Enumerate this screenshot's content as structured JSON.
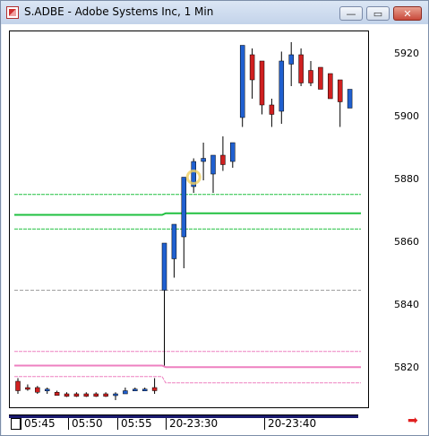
{
  "window": {
    "title": "S.ADBE - Adobe Systems Inc, 1 Min",
    "icon": "chart-app-icon",
    "buttons": {
      "minimize": "—",
      "maximize": "▭",
      "close": "✕"
    }
  },
  "chart_data": {
    "type": "candlestick",
    "title": "",
    "y_ticks": [
      "5920",
      "5900",
      "5880",
      "5860",
      "5840",
      "5820"
    ],
    "ylim": [
      5808,
      5928
    ],
    "x_tick_labels": [
      "05:45",
      "05:50",
      "05:55",
      "20-23:30",
      "20-23:40"
    ],
    "colors": {
      "up": "#2060d0",
      "down": "#d02020",
      "green_band": "#20c040",
      "pink_band": "#ee80c0",
      "gray_line": "#a0a0a0"
    },
    "candles": [
      {
        "o": 5816,
        "h": 5817,
        "l": 5812,
        "c": 5813
      },
      {
        "o": 5814,
        "h": 5815,
        "l": 5813,
        "c": 5813.5
      },
      {
        "o": 5814,
        "h": 5814.5,
        "l": 5812,
        "c": 5812.5
      },
      {
        "o": 5813,
        "h": 5814,
        "l": 5812,
        "c": 5813.5
      },
      {
        "o": 5812.5,
        "h": 5813,
        "l": 5811.5,
        "c": 5811.5
      },
      {
        "o": 5812,
        "h": 5812.5,
        "l": 5811,
        "c": 5811.2
      },
      {
        "o": 5812,
        "h": 5812.5,
        "l": 5811,
        "c": 5811.2
      },
      {
        "o": 5812,
        "h": 5812.5,
        "l": 5811,
        "c": 5811.2
      },
      {
        "o": 5812,
        "h": 5812.5,
        "l": 5811,
        "c": 5811.2
      },
      {
        "o": 5812,
        "h": 5812.5,
        "l": 5811,
        "c": 5811.2
      },
      {
        "o": 5811.5,
        "h": 5812.5,
        "l": 5810,
        "c": 5812
      },
      {
        "o": 5812,
        "h": 5814,
        "l": 5812,
        "c": 5813
      },
      {
        "o": 5813,
        "h": 5814,
        "l": 5813,
        "c": 5813.5
      },
      {
        "o": 5813,
        "h": 5814,
        "l": 5813,
        "c": 5813.5
      },
      {
        "o": 5814,
        "h": 5817,
        "l": 5812,
        "c": 5813
      },
      {
        "o": 5845,
        "h": 5860,
        "l": 5821,
        "c": 5860
      },
      {
        "o": 5855,
        "h": 5866,
        "l": 5849,
        "c": 5866
      },
      {
        "o": 5862,
        "h": 5881,
        "l": 5852,
        "c": 5881
      },
      {
        "o": 5878,
        "h": 5887,
        "l": 5876,
        "c": 5886
      },
      {
        "o": 5886,
        "h": 5892,
        "l": 5880,
        "c": 5887
      },
      {
        "o": 5882,
        "h": 5888,
        "l": 5876,
        "c": 5888
      },
      {
        "o": 5888,
        "h": 5894,
        "l": 5883,
        "c": 5885
      },
      {
        "o": 5886,
        "h": 5892,
        "l": 5884,
        "c": 5892
      },
      {
        "o": 5900,
        "h": 5923,
        "l": 5897,
        "c": 5923
      },
      {
        "o": 5920,
        "h": 5922,
        "l": 5906,
        "c": 5912
      },
      {
        "o": 5918,
        "h": 5918,
        "l": 5901,
        "c": 5904
      },
      {
        "o": 5904,
        "h": 5906,
        "l": 5897,
        "c": 5901
      },
      {
        "o": 5902,
        "h": 5921,
        "l": 5898,
        "c": 5918
      },
      {
        "o": 5917,
        "h": 5924,
        "l": 5910,
        "c": 5920
      },
      {
        "o": 5920,
        "h": 5922,
        "l": 5910,
        "c": 5911
      },
      {
        "o": 5915,
        "h": 5918,
        "l": 5910,
        "c": 5911
      },
      {
        "o": 5916,
        "h": 5916,
        "l": 5909,
        "c": 5909
      },
      {
        "o": 5914,
        "h": 5914,
        "l": 5906,
        "c": 5906
      },
      {
        "o": 5912,
        "h": 5912,
        "l": 5897,
        "c": 5905
      },
      {
        "o": 5903,
        "h": 5909,
        "l": 5903,
        "c": 5909
      }
    ],
    "bands": [
      {
        "name": "",
        "color": "#20c040",
        "left": [
          5875.5,
          5869,
          5864.5
        ],
        "right": [
          5875.5,
          5869.5,
          5864.5
        ]
      },
      {
        "name": "",
        "color": "#ee80c0",
        "left": [
          5825.5,
          5821,
          5817.5
        ],
        "right": [
          5825.5,
          5820.5,
          5815.5
        ]
      }
    ],
    "gray_line": 5845
  },
  "time_axis": {
    "labels": [
      "05:45",
      "05:50",
      "05:55",
      "20-23:30",
      "20-23:40"
    ]
  },
  "scroll": {
    "right_arrow": "➡"
  }
}
